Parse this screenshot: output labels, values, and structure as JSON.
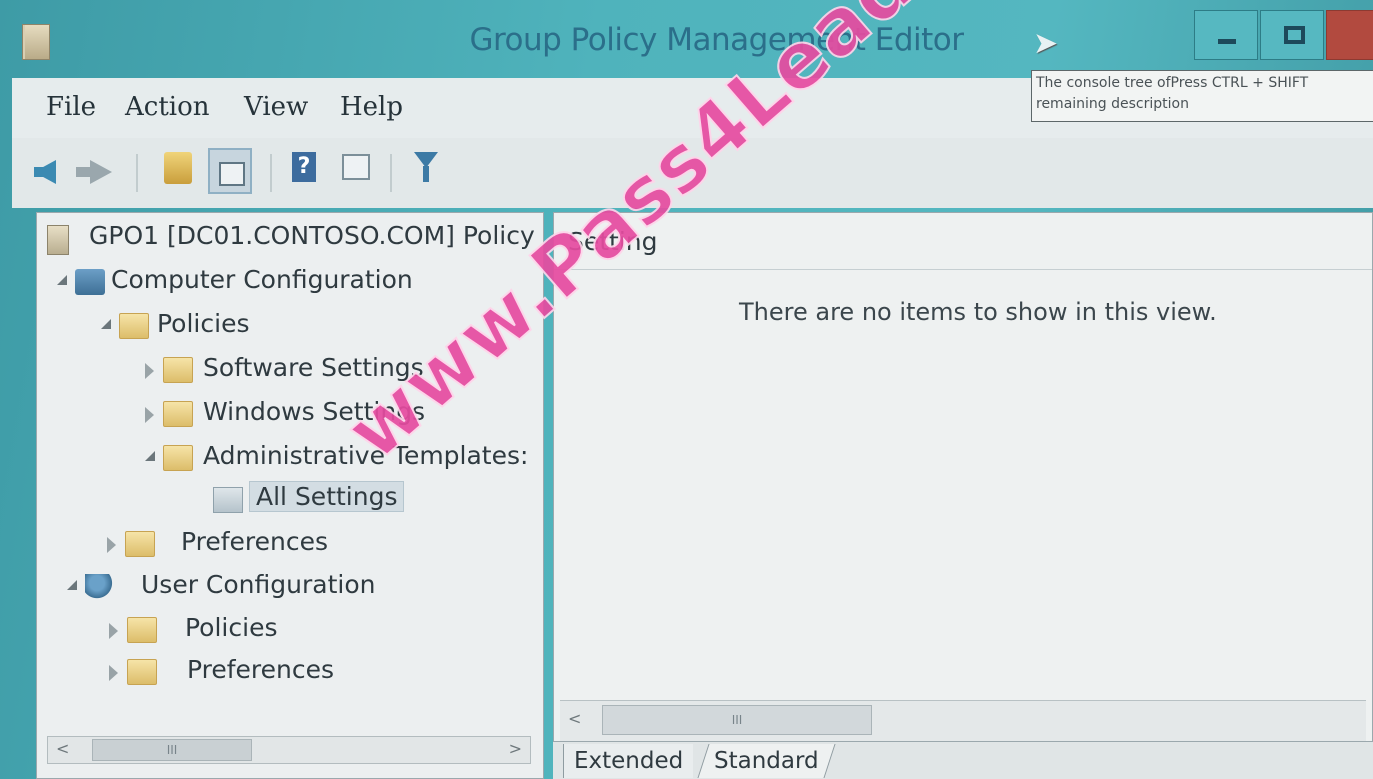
{
  "window": {
    "title": "Group Policy Management Editor"
  },
  "menu": {
    "items": [
      "File",
      "Action",
      "View",
      "Help"
    ]
  },
  "tooltip": {
    "line1": "The console tree ofPress CTRL + SHIFT",
    "line2": "remaining description"
  },
  "toolbar": {
    "icons": [
      "back-arrow-icon",
      "forward-arrow-icon",
      "up-folder-icon",
      "show-hide-console-tree-icon",
      "help-icon",
      "show-hide-action-pane-icon",
      "filter-icon"
    ]
  },
  "tree": {
    "root": "GPO1 [DC01.CONTOSO.COM] Policy",
    "computer_configuration": "Computer Configuration",
    "cc_policies": "Policies",
    "software_settings": "Software Settings",
    "windows_settings": "Windows Settings",
    "administrative_templates": "Administrative Templates:",
    "all_settings": "All Settings",
    "cc_preferences": "Preferences",
    "user_configuration": "User Configuration",
    "uc_policies": "Policies",
    "uc_preferences": "Preferences",
    "scroll_thumb": "III"
  },
  "result": {
    "column_header": "Setting",
    "empty_message": "There are no items to show in this view.",
    "scroll_thumb": "III"
  },
  "tabs": {
    "extended": "Extended",
    "standard": "Standard"
  },
  "watermark": {
    "text": "www.Pass4Lead.com",
    "color": "#e64ba0"
  }
}
